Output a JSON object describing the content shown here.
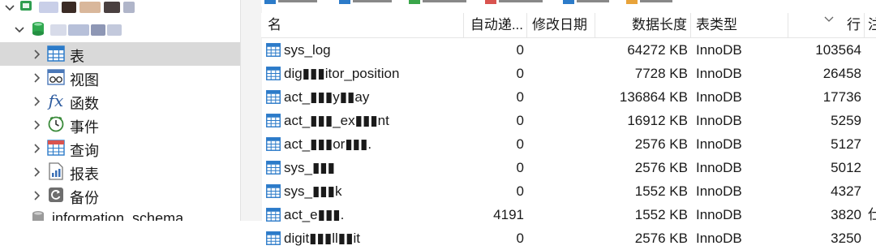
{
  "nav": {
    "items": [
      {
        "label": "表",
        "icon": "table-icon",
        "selected": true
      },
      {
        "label": "视图",
        "icon": "view-icon"
      },
      {
        "label": "函数",
        "icon": "function-icon"
      },
      {
        "label": "事件",
        "icon": "event-clock-icon"
      },
      {
        "label": "查询",
        "icon": "query-icon"
      },
      {
        "label": "报表",
        "icon": "report-icon"
      },
      {
        "label": "备份",
        "icon": "backup-icon"
      }
    ],
    "schema_partial_label": "information_schema"
  },
  "grid": {
    "columns": [
      "名",
      "自动递...",
      "修改日期",
      "数据长度",
      "表类型",
      "行",
      "注"
    ],
    "rows": [
      {
        "name": "sys_log",
        "auto": "0",
        "modified": "",
        "data_length": "64272 KB",
        "engine": "InnoDB",
        "rows": "103564",
        "comment": ""
      },
      {
        "name": "dig▮▮▮itor_position",
        "auto": "0",
        "modified": "",
        "data_length": "7728 KB",
        "engine": "InnoDB",
        "rows": "26458",
        "comment": ""
      },
      {
        "name": "act_▮▮▮y▮▮ay",
        "auto": "0",
        "modified": "",
        "data_length": "136864 KB",
        "engine": "InnoDB",
        "rows": "17736",
        "comment": ""
      },
      {
        "name": "act_▮▮▮_ex▮▮▮nt",
        "auto": "0",
        "modified": "",
        "data_length": "16912 KB",
        "engine": "InnoDB",
        "rows": "5259",
        "comment": ""
      },
      {
        "name": "act_▮▮▮or▮▮▮.",
        "auto": "0",
        "modified": "",
        "data_length": "2576 KB",
        "engine": "InnoDB",
        "rows": "5127",
        "comment": ""
      },
      {
        "name": "sys_▮▮▮",
        "auto": "0",
        "modified": "",
        "data_length": "2576 KB",
        "engine": "InnoDB",
        "rows": "5012",
        "comment": ""
      },
      {
        "name": "sys_▮▮▮k",
        "auto": "0",
        "modified": "",
        "data_length": "1552 KB",
        "engine": "InnoDB",
        "rows": "4327",
        "comment": ""
      },
      {
        "name": "act_e▮▮▮.",
        "auto": "4191",
        "modified": "",
        "data_length": "1552 KB",
        "engine": "InnoDB",
        "rows": "3820",
        "comment": "仕"
      },
      {
        "name": "digit▮▮▮ll▮▮it",
        "auto": "0",
        "modified": "",
        "data_length": "2576 KB",
        "engine": "InnoDB",
        "rows": "3250",
        "comment": ""
      }
    ]
  }
}
